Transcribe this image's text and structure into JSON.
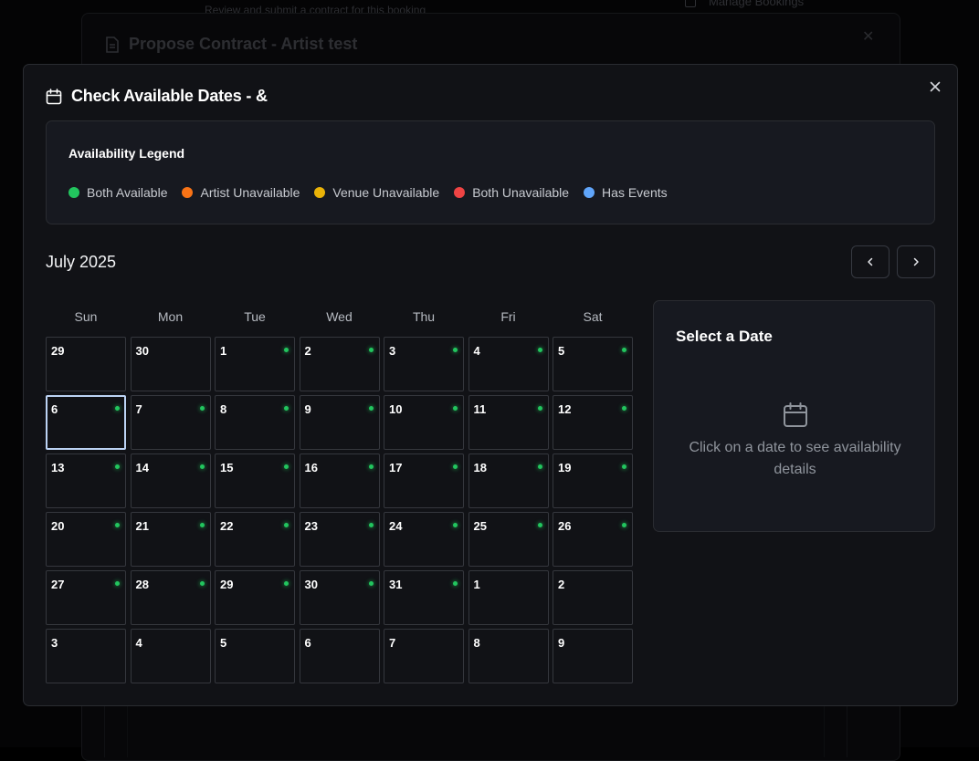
{
  "background": {
    "top_fragment": "Review and submit a contract for this booking",
    "manage_label": "Manage Bookings",
    "underlying_modal_title": "Propose Contract - Artist test"
  },
  "dialog": {
    "title": "Check Available Dates - &",
    "close_icon": "close-icon",
    "title_icon": "calendar-icon"
  },
  "legend": {
    "title": "Availability Legend",
    "items": [
      {
        "label": "Both Available",
        "color": "#22c55e"
      },
      {
        "label": "Artist Unavailable",
        "color": "#f97316"
      },
      {
        "label": "Venue Unavailable",
        "color": "#eab308"
      },
      {
        "label": "Both Unavailable",
        "color": "#ef4444"
      },
      {
        "label": "Has Events",
        "color": "#60a5fa"
      }
    ]
  },
  "calendar": {
    "month_label": "July 2025",
    "prev_icon": "chevron-left-icon",
    "next_icon": "chevron-right-icon",
    "weekdays": [
      "Sun",
      "Mon",
      "Tue",
      "Wed",
      "Thu",
      "Fri",
      "Sat"
    ],
    "selected_day": "6",
    "days": [
      {
        "d": "29",
        "dot": false
      },
      {
        "d": "30",
        "dot": false
      },
      {
        "d": "1",
        "dot": true
      },
      {
        "d": "2",
        "dot": true
      },
      {
        "d": "3",
        "dot": true
      },
      {
        "d": "4",
        "dot": true
      },
      {
        "d": "5",
        "dot": true
      },
      {
        "d": "6",
        "dot": true,
        "selected": true
      },
      {
        "d": "7",
        "dot": true
      },
      {
        "d": "8",
        "dot": true
      },
      {
        "d": "9",
        "dot": true
      },
      {
        "d": "10",
        "dot": true
      },
      {
        "d": "11",
        "dot": true
      },
      {
        "d": "12",
        "dot": true
      },
      {
        "d": "13",
        "dot": true
      },
      {
        "d": "14",
        "dot": true
      },
      {
        "d": "15",
        "dot": true
      },
      {
        "d": "16",
        "dot": true
      },
      {
        "d": "17",
        "dot": true
      },
      {
        "d": "18",
        "dot": true
      },
      {
        "d": "19",
        "dot": true
      },
      {
        "d": "20",
        "dot": true
      },
      {
        "d": "21",
        "dot": true
      },
      {
        "d": "22",
        "dot": true
      },
      {
        "d": "23",
        "dot": true
      },
      {
        "d": "24",
        "dot": true
      },
      {
        "d": "25",
        "dot": true
      },
      {
        "d": "26",
        "dot": true
      },
      {
        "d": "27",
        "dot": true
      },
      {
        "d": "28",
        "dot": true
      },
      {
        "d": "29",
        "dot": true
      },
      {
        "d": "30",
        "dot": true
      },
      {
        "d": "31",
        "dot": true
      },
      {
        "d": "1",
        "dot": false
      },
      {
        "d": "2",
        "dot": false
      },
      {
        "d": "3",
        "dot": false
      },
      {
        "d": "4",
        "dot": false
      },
      {
        "d": "5",
        "dot": false
      },
      {
        "d": "6",
        "dot": false
      },
      {
        "d": "7",
        "dot": false
      },
      {
        "d": "8",
        "dot": false
      },
      {
        "d": "9",
        "dot": false
      }
    ]
  },
  "side_panel": {
    "title": "Select a Date",
    "icon": "calendar-icon",
    "message": "Click on a date to see availability details"
  }
}
